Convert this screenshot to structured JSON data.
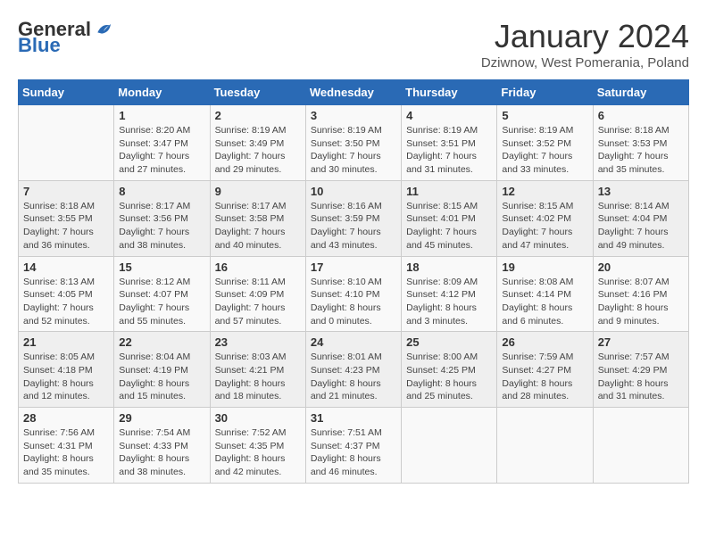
{
  "header": {
    "logo_general": "General",
    "logo_blue": "Blue",
    "month_title": "January 2024",
    "location": "Dziwnow, West Pomerania, Poland"
  },
  "weekdays": [
    "Sunday",
    "Monday",
    "Tuesday",
    "Wednesday",
    "Thursday",
    "Friday",
    "Saturday"
  ],
  "weeks": [
    [
      {
        "day": "",
        "sunrise": "",
        "sunset": "",
        "daylight": ""
      },
      {
        "day": "1",
        "sunrise": "Sunrise: 8:20 AM",
        "sunset": "Sunset: 3:47 PM",
        "daylight": "Daylight: 7 hours and 27 minutes."
      },
      {
        "day": "2",
        "sunrise": "Sunrise: 8:19 AM",
        "sunset": "Sunset: 3:49 PM",
        "daylight": "Daylight: 7 hours and 29 minutes."
      },
      {
        "day": "3",
        "sunrise": "Sunrise: 8:19 AM",
        "sunset": "Sunset: 3:50 PM",
        "daylight": "Daylight: 7 hours and 30 minutes."
      },
      {
        "day": "4",
        "sunrise": "Sunrise: 8:19 AM",
        "sunset": "Sunset: 3:51 PM",
        "daylight": "Daylight: 7 hours and 31 minutes."
      },
      {
        "day": "5",
        "sunrise": "Sunrise: 8:19 AM",
        "sunset": "Sunset: 3:52 PM",
        "daylight": "Daylight: 7 hours and 33 minutes."
      },
      {
        "day": "6",
        "sunrise": "Sunrise: 8:18 AM",
        "sunset": "Sunset: 3:53 PM",
        "daylight": "Daylight: 7 hours and 35 minutes."
      }
    ],
    [
      {
        "day": "7",
        "sunrise": "Sunrise: 8:18 AM",
        "sunset": "Sunset: 3:55 PM",
        "daylight": "Daylight: 7 hours and 36 minutes."
      },
      {
        "day": "8",
        "sunrise": "Sunrise: 8:17 AM",
        "sunset": "Sunset: 3:56 PM",
        "daylight": "Daylight: 7 hours and 38 minutes."
      },
      {
        "day": "9",
        "sunrise": "Sunrise: 8:17 AM",
        "sunset": "Sunset: 3:58 PM",
        "daylight": "Daylight: 7 hours and 40 minutes."
      },
      {
        "day": "10",
        "sunrise": "Sunrise: 8:16 AM",
        "sunset": "Sunset: 3:59 PM",
        "daylight": "Daylight: 7 hours and 43 minutes."
      },
      {
        "day": "11",
        "sunrise": "Sunrise: 8:15 AM",
        "sunset": "Sunset: 4:01 PM",
        "daylight": "Daylight: 7 hours and 45 minutes."
      },
      {
        "day": "12",
        "sunrise": "Sunrise: 8:15 AM",
        "sunset": "Sunset: 4:02 PM",
        "daylight": "Daylight: 7 hours and 47 minutes."
      },
      {
        "day": "13",
        "sunrise": "Sunrise: 8:14 AM",
        "sunset": "Sunset: 4:04 PM",
        "daylight": "Daylight: 7 hours and 49 minutes."
      }
    ],
    [
      {
        "day": "14",
        "sunrise": "Sunrise: 8:13 AM",
        "sunset": "Sunset: 4:05 PM",
        "daylight": "Daylight: 7 hours and 52 minutes."
      },
      {
        "day": "15",
        "sunrise": "Sunrise: 8:12 AM",
        "sunset": "Sunset: 4:07 PM",
        "daylight": "Daylight: 7 hours and 55 minutes."
      },
      {
        "day": "16",
        "sunrise": "Sunrise: 8:11 AM",
        "sunset": "Sunset: 4:09 PM",
        "daylight": "Daylight: 7 hours and 57 minutes."
      },
      {
        "day": "17",
        "sunrise": "Sunrise: 8:10 AM",
        "sunset": "Sunset: 4:10 PM",
        "daylight": "Daylight: 8 hours and 0 minutes."
      },
      {
        "day": "18",
        "sunrise": "Sunrise: 8:09 AM",
        "sunset": "Sunset: 4:12 PM",
        "daylight": "Daylight: 8 hours and 3 minutes."
      },
      {
        "day": "19",
        "sunrise": "Sunrise: 8:08 AM",
        "sunset": "Sunset: 4:14 PM",
        "daylight": "Daylight: 8 hours and 6 minutes."
      },
      {
        "day": "20",
        "sunrise": "Sunrise: 8:07 AM",
        "sunset": "Sunset: 4:16 PM",
        "daylight": "Daylight: 8 hours and 9 minutes."
      }
    ],
    [
      {
        "day": "21",
        "sunrise": "Sunrise: 8:05 AM",
        "sunset": "Sunset: 4:18 PM",
        "daylight": "Daylight: 8 hours and 12 minutes."
      },
      {
        "day": "22",
        "sunrise": "Sunrise: 8:04 AM",
        "sunset": "Sunset: 4:19 PM",
        "daylight": "Daylight: 8 hours and 15 minutes."
      },
      {
        "day": "23",
        "sunrise": "Sunrise: 8:03 AM",
        "sunset": "Sunset: 4:21 PM",
        "daylight": "Daylight: 8 hours and 18 minutes."
      },
      {
        "day": "24",
        "sunrise": "Sunrise: 8:01 AM",
        "sunset": "Sunset: 4:23 PM",
        "daylight": "Daylight: 8 hours and 21 minutes."
      },
      {
        "day": "25",
        "sunrise": "Sunrise: 8:00 AM",
        "sunset": "Sunset: 4:25 PM",
        "daylight": "Daylight: 8 hours and 25 minutes."
      },
      {
        "day": "26",
        "sunrise": "Sunrise: 7:59 AM",
        "sunset": "Sunset: 4:27 PM",
        "daylight": "Daylight: 8 hours and 28 minutes."
      },
      {
        "day": "27",
        "sunrise": "Sunrise: 7:57 AM",
        "sunset": "Sunset: 4:29 PM",
        "daylight": "Daylight: 8 hours and 31 minutes."
      }
    ],
    [
      {
        "day": "28",
        "sunrise": "Sunrise: 7:56 AM",
        "sunset": "Sunset: 4:31 PM",
        "daylight": "Daylight: 8 hours and 35 minutes."
      },
      {
        "day": "29",
        "sunrise": "Sunrise: 7:54 AM",
        "sunset": "Sunset: 4:33 PM",
        "daylight": "Daylight: 8 hours and 38 minutes."
      },
      {
        "day": "30",
        "sunrise": "Sunrise: 7:52 AM",
        "sunset": "Sunset: 4:35 PM",
        "daylight": "Daylight: 8 hours and 42 minutes."
      },
      {
        "day": "31",
        "sunrise": "Sunrise: 7:51 AM",
        "sunset": "Sunset: 4:37 PM",
        "daylight": "Daylight: 8 hours and 46 minutes."
      },
      {
        "day": "",
        "sunrise": "",
        "sunset": "",
        "daylight": ""
      },
      {
        "day": "",
        "sunrise": "",
        "sunset": "",
        "daylight": ""
      },
      {
        "day": "",
        "sunrise": "",
        "sunset": "",
        "daylight": ""
      }
    ]
  ]
}
